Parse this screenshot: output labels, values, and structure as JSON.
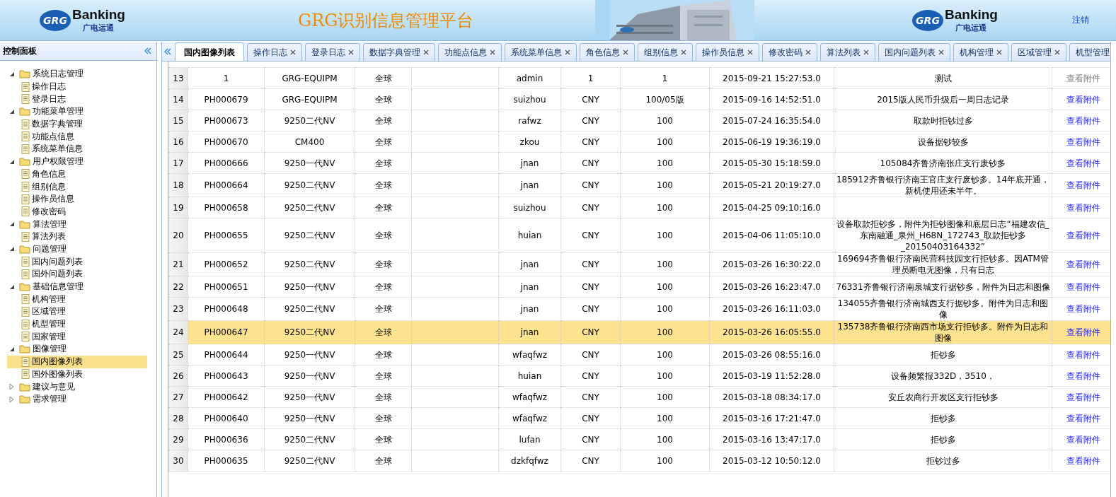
{
  "header": {
    "title": "GRG识别信息管理平台",
    "logos": [
      {
        "mark": "GRG",
        "name": "Banking",
        "sub": "广电运通"
      },
      {
        "mark": "GRG",
        "name": "Banking",
        "sub": "广电运通"
      }
    ],
    "logout": "注销"
  },
  "sidebar": {
    "title": "控制面板",
    "items": [
      {
        "label": "系统日志管理",
        "expanded": true,
        "selected": false,
        "children": [
          {
            "label": "操作日志",
            "selected": false
          },
          {
            "label": "登录日志",
            "selected": false
          }
        ]
      },
      {
        "label": "功能菜单管理",
        "expanded": true,
        "selected": false,
        "children": [
          {
            "label": "数据字典管理",
            "selected": false
          },
          {
            "label": "功能点信息",
            "selected": false
          },
          {
            "label": "系统菜单信息",
            "selected": false
          }
        ]
      },
      {
        "label": "用户权限管理",
        "expanded": true,
        "selected": false,
        "children": [
          {
            "label": "角色信息",
            "selected": false
          },
          {
            "label": "组别信息",
            "selected": false
          },
          {
            "label": "操作员信息",
            "selected": false
          },
          {
            "label": "修改密码",
            "selected": false
          }
        ]
      },
      {
        "label": "算法管理",
        "expanded": true,
        "selected": false,
        "children": [
          {
            "label": "算法列表",
            "selected": false
          }
        ]
      },
      {
        "label": "问题管理",
        "expanded": true,
        "selected": false,
        "children": [
          {
            "label": "国内问题列表",
            "selected": false
          },
          {
            "label": "国外问题列表",
            "selected": false
          }
        ]
      },
      {
        "label": "基础信息管理",
        "expanded": true,
        "selected": false,
        "children": [
          {
            "label": "机构管理",
            "selected": false
          },
          {
            "label": "区域管理",
            "selected": false
          },
          {
            "label": "机型管理",
            "selected": false
          },
          {
            "label": "国家管理",
            "selected": false
          }
        ]
      },
      {
        "label": "图像管理",
        "expanded": true,
        "selected": false,
        "children": [
          {
            "label": "国内图像列表",
            "selected": true
          },
          {
            "label": "国外图像列表",
            "selected": false
          }
        ]
      },
      {
        "label": "建议与意见",
        "expanded": false,
        "selected": false
      },
      {
        "label": "需求管理",
        "expanded": false,
        "selected": false
      }
    ]
  },
  "tabs": [
    {
      "label": "国内图像列表",
      "selected": true,
      "closable": false
    },
    {
      "label": "操作日志",
      "selected": false,
      "closable": true
    },
    {
      "label": "登录日志",
      "selected": false,
      "closable": true
    },
    {
      "label": "数据字典管理",
      "selected": false,
      "closable": true
    },
    {
      "label": "功能点信息",
      "selected": false,
      "closable": true
    },
    {
      "label": "系统菜单信息",
      "selected": false,
      "closable": true
    },
    {
      "label": "角色信息",
      "selected": false,
      "closable": true
    },
    {
      "label": "组别信息",
      "selected": false,
      "closable": true
    },
    {
      "label": "操作员信息",
      "selected": false,
      "closable": true
    },
    {
      "label": "修改密码",
      "selected": false,
      "closable": true
    },
    {
      "label": "算法列表",
      "selected": false,
      "closable": true
    },
    {
      "label": "国内问题列表",
      "selected": false,
      "closable": true
    },
    {
      "label": "机构管理",
      "selected": false,
      "closable": true
    },
    {
      "label": "区域管理",
      "selected": false,
      "closable": true
    },
    {
      "label": "机型管理",
      "selected": false,
      "closable": false
    }
  ],
  "table": {
    "rows": [
      {
        "num": "13",
        "cells": [
          "1",
          "GRG-EQUIPM",
          "全球",
          "",
          "admin",
          "1",
          "1",
          "2015-09-21 15:27:53.0",
          "测试"
        ],
        "link": "查看附件",
        "disabled": true,
        "selected": false
      },
      {
        "num": "14",
        "cells": [
          "PH000679",
          "GRG-EQUIPM",
          "全球",
          "",
          "suizhou",
          "CNY",
          "100/05版",
          "2015-09-16 14:52:51.0",
          "2015版人民币升级后一周日志记录"
        ],
        "link": "查看附件",
        "disabled": false,
        "selected": false
      },
      {
        "num": "15",
        "cells": [
          "PH000673",
          "9250二代NV",
          "全球",
          "",
          "rafwz",
          "CNY",
          "100",
          "2015-07-24 16:35:54.0",
          "取款时拒钞过多"
        ],
        "link": "查看附件",
        "disabled": false,
        "selected": false
      },
      {
        "num": "16",
        "cells": [
          "PH000670",
          "CM400",
          "全球",
          "",
          "zkou",
          "CNY",
          "100",
          "2015-06-19 19:36:19.0",
          "设备据钞较多"
        ],
        "link": "查看附件",
        "disabled": false,
        "selected": false
      },
      {
        "num": "17",
        "cells": [
          "PH000666",
          "9250一代NV",
          "全球",
          "",
          "jnan",
          "CNY",
          "100",
          "2015-05-30 15:18:59.0",
          "105084齐鲁济南张庄支行废钞多"
        ],
        "link": "查看附件",
        "disabled": false,
        "selected": false
      },
      {
        "num": "18",
        "cells": [
          "PH000664",
          "9250二代NV",
          "全球",
          "",
          "jnan",
          "CNY",
          "100",
          "2015-05-21 20:19:27.0",
          "185912齐鲁银行济南王官庄支行废钞多。14年底开通，新机使用还未半年。"
        ],
        "link": "查看附件",
        "disabled": false,
        "selected": false
      },
      {
        "num": "19",
        "cells": [
          "PH000658",
          "9250二代NV",
          "全球",
          "",
          "suizhou",
          "CNY",
          "100",
          "2015-04-25 09:10:16.0",
          ""
        ],
        "link": "查看附件",
        "disabled": false,
        "selected": false
      },
      {
        "num": "20",
        "cells": [
          "PH000655",
          "9250二代NV",
          "全球",
          "",
          "huian",
          "CNY",
          "100",
          "2015-04-06 11:05:10.0",
          "设备取款拒钞多，附件为拒钞图像和底层日志“福建农信_东南融通_泉州_H68N_172743_取款拒钞多_20150403164332”"
        ],
        "link": "查看附件",
        "disabled": false,
        "selected": false
      },
      {
        "num": "21",
        "cells": [
          "PH000652",
          "9250二代NV",
          "全球",
          "",
          "jnan",
          "CNY",
          "100",
          "2015-03-26 16:30:22.0",
          "169694齐鲁银行济南民营科技园支行拒钞多。因ATM管理员断电无图像，只有日志"
        ],
        "link": "查看附件",
        "disabled": false,
        "selected": false
      },
      {
        "num": "22",
        "cells": [
          "PH000651",
          "9250一代NV",
          "全球",
          "",
          "jnan",
          "CNY",
          "100",
          "2015-03-26 16:23:47.0",
          "76331齐鲁银行济南泉城支行据钞多，附件为日志和图像"
        ],
        "link": "查看附件",
        "disabled": false,
        "selected": false
      },
      {
        "num": "23",
        "cells": [
          "PH000648",
          "9250二代NV",
          "全球",
          "",
          "jnan",
          "CNY",
          "100",
          "2015-03-26 16:11:03.0",
          "134055齐鲁银行济南城西支行据钞多。附件为日志和图像"
        ],
        "link": "查看附件",
        "disabled": false,
        "selected": false
      },
      {
        "num": "24",
        "cells": [
          "PH000647",
          "9250二代NV",
          "全球",
          "",
          "jnan",
          "CNY",
          "100",
          "2015-03-26 16:05:55.0",
          "135738齐鲁银行济南西市场支行拒钞多。附件为日志和图像"
        ],
        "link": "查看附件",
        "disabled": false,
        "selected": true
      },
      {
        "num": "25",
        "cells": [
          "PH000644",
          "9250一代NV",
          "全球",
          "",
          "wfaqfwz",
          "CNY",
          "100",
          "2015-03-26 08:55:16.0",
          "拒钞多"
        ],
        "link": "查看附件",
        "disabled": false,
        "selected": false
      },
      {
        "num": "26",
        "cells": [
          "PH000643",
          "9250一代NV",
          "全球",
          "",
          "huian",
          "CNY",
          "100",
          "2015-03-19 11:52:28.0",
          "设备频繁报332D，3510，"
        ],
        "link": "查看附件",
        "disabled": false,
        "selected": false
      },
      {
        "num": "27",
        "cells": [
          "PH000642",
          "9250一代NV",
          "全球",
          "",
          "wfaqfwz",
          "CNY",
          "100",
          "2015-03-18 08:34:17.0",
          "安丘农商行开发区支行拒钞多"
        ],
        "link": "查看附件",
        "disabled": false,
        "selected": false
      },
      {
        "num": "28",
        "cells": [
          "PH000640",
          "9250一代NV",
          "全球",
          "",
          "wfaqfwz",
          "CNY",
          "100",
          "2015-03-16 17:21:47.0",
          "拒钞多"
        ],
        "link": "查看附件",
        "disabled": false,
        "selected": false
      },
      {
        "num": "29",
        "cells": [
          "PH000636",
          "9250二代NV",
          "全球",
          "",
          "lufan",
          "CNY",
          "100",
          "2015-03-16 13:47:17.0",
          "拒钞多"
        ],
        "link": "查看附件",
        "disabled": false,
        "selected": false
      },
      {
        "num": "30",
        "cells": [
          "PH000635",
          "9250二代NV",
          "全球",
          "",
          "dzkfqfwz",
          "CNY",
          "100",
          "2015-03-12 10:50:12.0",
          "拒钞过多"
        ],
        "link": "查看附件",
        "disabled": false,
        "selected": false
      }
    ]
  }
}
